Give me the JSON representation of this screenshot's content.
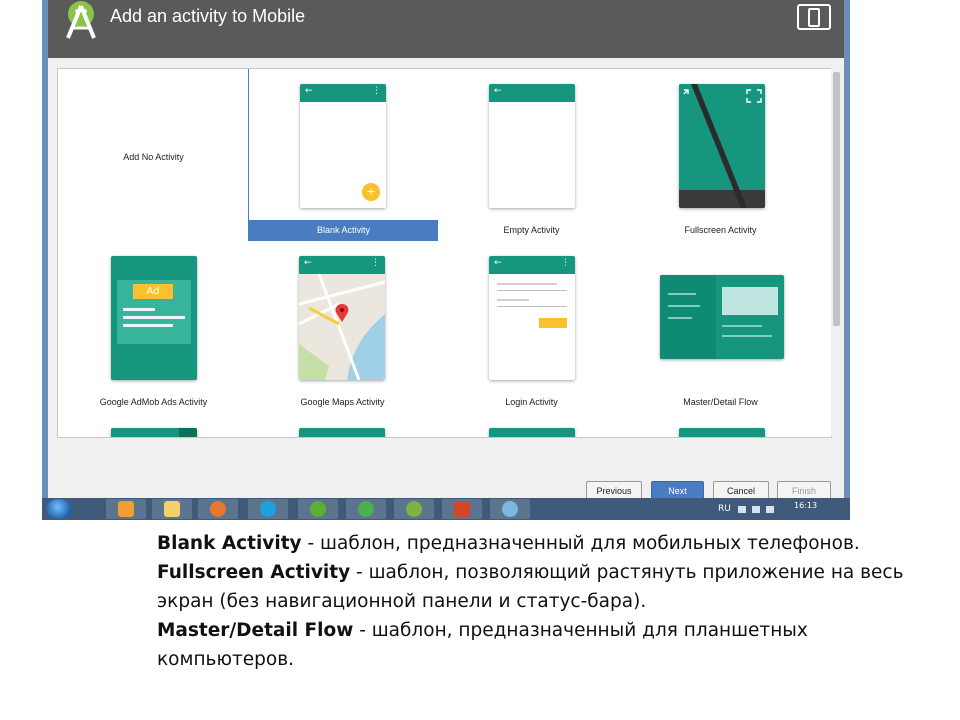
{
  "dialog": {
    "title": "Add an activity to Mobile",
    "icons": {
      "logo": "android-studio-logo-icon",
      "device": "phone-tablet-device-icon"
    }
  },
  "templates": [
    {
      "label": "Add No Activity",
      "selected": false
    },
    {
      "label": "Blank Activity",
      "selected": true
    },
    {
      "label": "Empty Activity",
      "selected": false
    },
    {
      "label": "Fullscreen Activity",
      "selected": false
    },
    {
      "label": "Google AdMob Ads Activity",
      "selected": false,
      "ad_badge": "Ad"
    },
    {
      "label": "Google Maps Activity",
      "selected": false
    },
    {
      "label": "Login Activity",
      "selected": false
    },
    {
      "label": "Master/Detail Flow",
      "selected": false
    }
  ],
  "buttons": {
    "previous": "Previous",
    "next": "Next",
    "cancel": "Cancel",
    "finish": "Finish"
  },
  "taskbar": {
    "language": "RU",
    "time": "16:13",
    "apps": [
      "outlook-icon",
      "file-explorer-icon",
      "firefox-icon",
      "skype-icon",
      "utorrent-icon",
      "spotify-icon",
      "android-studio-icon",
      "powerpoint-icon",
      "paint-icon"
    ]
  },
  "description": [
    {
      "term": "Blank Activity",
      "text": " - шаблон, предназначенный для мобильных телефонов."
    },
    {
      "term": "Fullscreen Activity",
      "text": " - шаблон, позволяющий растянуть приложение на весь",
      "cont": "экран (без навигационной панели и статус-бара)."
    },
    {
      "term": "Master/Detail Flow",
      "text": " - шаблон, предназначенный для планшетных",
      "cont": "компьютеров."
    }
  ],
  "colors": {
    "title_bar": "#5a5a5a",
    "android_green": "#16967f",
    "selection_blue": "#4a7cc2",
    "fab_yellow": "#fbc02d",
    "taskbar": "#3f5a7a"
  }
}
